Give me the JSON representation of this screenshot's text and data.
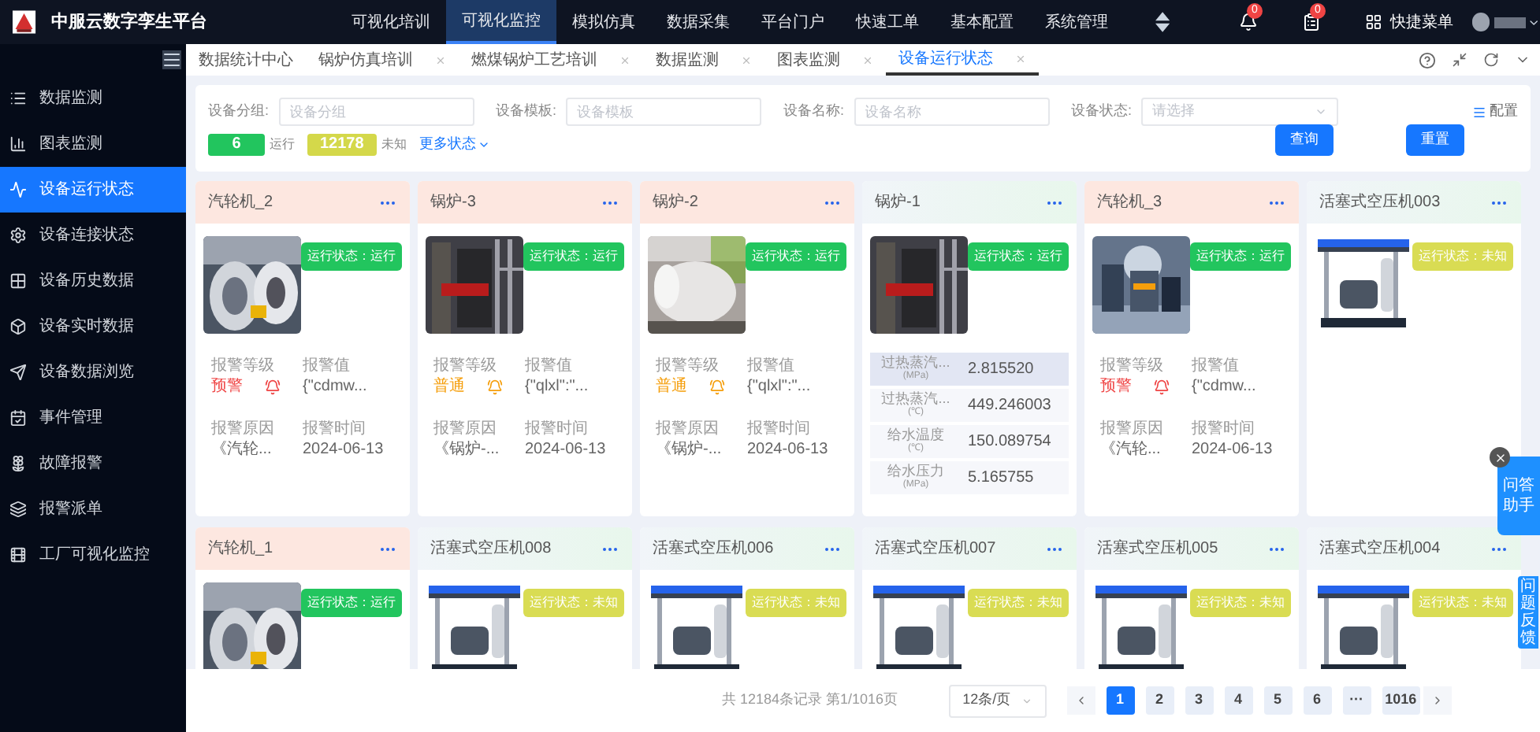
{
  "app": {
    "title": "中服云数字孪生平台"
  },
  "nav": [
    {
      "label": "可视化培训",
      "selected": false
    },
    {
      "label": "可视化监控",
      "selected": true
    },
    {
      "label": "模拟仿真",
      "selected": false
    },
    {
      "label": "数据采集",
      "selected": false
    },
    {
      "label": "平台门户",
      "selected": false
    },
    {
      "label": "快速工单",
      "selected": false
    },
    {
      "label": "基本配置",
      "selected": false
    },
    {
      "label": "系统管理",
      "selected": false
    }
  ],
  "header_tools": {
    "notifications": "0",
    "tasks": "0",
    "quick_menu": "快捷菜单"
  },
  "tabs": [
    {
      "label": "数据统计中心",
      "selected": false,
      "closable": false
    },
    {
      "label": "锅炉仿真培训",
      "selected": false,
      "closable": true
    },
    {
      "label": "燃煤锅炉工艺培训",
      "selected": false,
      "closable": true
    },
    {
      "label": "数据监测",
      "selected": false,
      "closable": true
    },
    {
      "label": "图表监测",
      "selected": false,
      "closable": true
    },
    {
      "label": "设备运行状态",
      "selected": true,
      "closable": true
    }
  ],
  "sidebar": {
    "items": [
      {
        "label": "数据监测",
        "selected": false
      },
      {
        "label": "图表监测",
        "selected": false
      },
      {
        "label": "设备运行状态",
        "selected": true
      },
      {
        "label": "设备连接状态",
        "selected": false
      },
      {
        "label": "设备历史数据",
        "selected": false
      },
      {
        "label": "设备实时数据",
        "selected": false
      },
      {
        "label": "设备数据浏览",
        "selected": false
      },
      {
        "label": "事件管理",
        "selected": false
      },
      {
        "label": "故障报警",
        "selected": false
      },
      {
        "label": "报警派单",
        "selected": false
      },
      {
        "label": "工厂可视化监控",
        "selected": false
      }
    ]
  },
  "filters": [
    {
      "label": "设备分组:",
      "placeholder": "设备分组",
      "kind": "input"
    },
    {
      "label": "设备模板:",
      "placeholder": "设备模板",
      "kind": "input"
    },
    {
      "label": "设备名称:",
      "placeholder": "设备名称",
      "kind": "input"
    },
    {
      "label": "设备状态:",
      "placeholder": "请选择",
      "kind": "select"
    }
  ],
  "config_link": "配置",
  "counts": [
    {
      "value": "6",
      "label": "运行",
      "color": "#22c55e"
    },
    {
      "value": "12178",
      "label": "未知",
      "color": "#d4d84a"
    }
  ],
  "more_status": "更多状态",
  "buttons": [
    "查询",
    "重置"
  ],
  "devices": [
    {
      "name": "汽轮机_2",
      "kind": "alarm",
      "status_text": "运行状态：运行",
      "color": "#22c55e",
      "alarm": {
        "color": "#ef4444",
        "fields": [
          {
            "label": "报警等级",
            "value": "预警"
          },
          {
            "label": "报警值",
            "value": "{\"cdmw..."
          },
          {
            "label": "报警原因",
            "value": "《汽轮..."
          },
          {
            "label": "报警时间",
            "value": "2024-06-13"
          }
        ]
      }
    },
    {
      "name": "锅炉-3",
      "kind": "alarm",
      "status_text": "运行状态：运行",
      "color": "#22c55e",
      "alarm": {
        "color": "#f59e0b",
        "fields": [
          {
            "label": "报警等级",
            "value": "普通"
          },
          {
            "label": "报警值",
            "value": "{\"qlxl\":\"..."
          },
          {
            "label": "报警原因",
            "value": "《锅炉-..."
          },
          {
            "label": "报警时间",
            "value": "2024-06-13"
          }
        ]
      }
    },
    {
      "name": "锅炉-2",
      "kind": "alarm",
      "status_text": "运行状态：运行",
      "color": "#22c55e",
      "alarm": {
        "color": "#f59e0b",
        "fields": [
          {
            "label": "报警等级",
            "value": "普通"
          },
          {
            "label": "报警值",
            "value": "{\"qlxl\":\"..."
          },
          {
            "label": "报警原因",
            "value": "《锅炉-..."
          },
          {
            "label": "报警时间",
            "value": "2024-06-13"
          }
        ]
      }
    },
    {
      "name": "锅炉-1",
      "kind": "normal",
      "status_text": "运行状态：运行",
      "color": "#22c55e",
      "readings": [
        {
          "name": "过热蒸汽...",
          "unit": "(MPa)",
          "value": "2.815520"
        },
        {
          "name": "过热蒸汽...",
          "unit": "(℃)",
          "value": "449.246003"
        },
        {
          "name": "给水温度",
          "unit": "(℃)",
          "value": "150.089754"
        },
        {
          "name": "给水压力",
          "unit": "(MPa)",
          "value": "5.165755"
        }
      ]
    },
    {
      "name": "汽轮机_3",
      "kind": "alarm",
      "status_text": "运行状态：运行",
      "color": "#22c55e",
      "alarm": {
        "color": "#ef4444",
        "fields": [
          {
            "label": "报警等级",
            "value": "预警"
          },
          {
            "label": "报警值",
            "value": "{\"cdmw..."
          },
          {
            "label": "报警原因",
            "value": "《汽轮..."
          },
          {
            "label": "报警时间",
            "value": "2024-06-13"
          }
        ]
      }
    },
    {
      "name": "活塞式空压机003",
      "kind": "normal",
      "status_text": "运行状态：未知",
      "color": "#d9dc53"
    },
    {
      "name": "汽轮机_1",
      "kind": "alarm",
      "status_text": "运行状态：运行",
      "color": "#22c55e"
    },
    {
      "name": "活塞式空压机008",
      "kind": "normal",
      "status_text": "运行状态：未知",
      "color": "#d9dc53"
    },
    {
      "name": "活塞式空压机006",
      "kind": "normal",
      "status_text": "运行状态：未知",
      "color": "#d9dc53"
    },
    {
      "name": "活塞式空压机007",
      "kind": "normal",
      "status_text": "运行状态：未知",
      "color": "#d9dc53"
    },
    {
      "name": "活塞式空压机005",
      "kind": "normal",
      "status_text": "运行状态：未知",
      "color": "#d9dc53"
    },
    {
      "name": "活塞式空压机004",
      "kind": "normal",
      "status_text": "运行状态：未知",
      "color": "#d9dc53"
    }
  ],
  "pagination": {
    "summary": "共 12184条记录 第1/1016页",
    "page_size": "12条/页",
    "pages": [
      {
        "label": "1",
        "selected": true
      },
      {
        "label": "2",
        "selected": false
      },
      {
        "label": "3",
        "selected": false
      },
      {
        "label": "4",
        "selected": false
      },
      {
        "label": "5",
        "selected": false
      },
      {
        "label": "6",
        "selected": false
      },
      {
        "label": "···",
        "selected": false
      },
      {
        "label": "1016",
        "selected": false
      }
    ]
  },
  "assistant": {
    "label": "问答助手"
  },
  "feedback": {
    "label": "问题反馈"
  }
}
